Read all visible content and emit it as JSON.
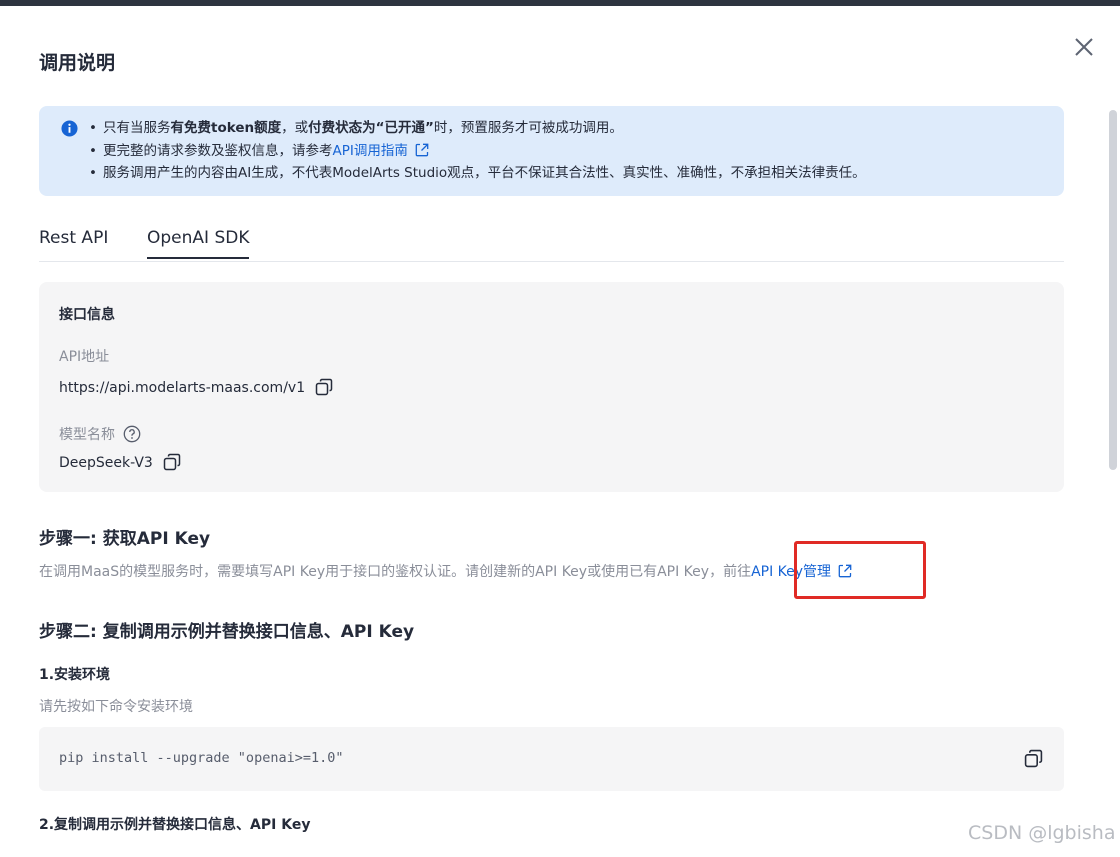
{
  "dialog": {
    "title": "调用说明"
  },
  "notice": {
    "line1": {
      "prefix": "只有当服务",
      "bold1": "有免费token额度",
      "mid": "，或",
      "bold2": "付费状态为“已开通”",
      "suffix": "时，预置服务才可被成功调用。"
    },
    "line2": {
      "prefix": "更完整的请求参数及鉴权信息，请参考",
      "link": "API调用指南"
    },
    "line3": "服务调用产生的内容由AI生成，不代表ModelArts Studio观点，平台不保证其合法性、真实性、准确性，不承担相关法律责任。",
    "bullet": "•"
  },
  "tabs": [
    {
      "label": "Rest API",
      "active": false
    },
    {
      "label": "OpenAI SDK",
      "active": true
    }
  ],
  "interface_info": {
    "title": "接口信息",
    "api_url_label": "API地址",
    "api_url_value": "https://api.modelarts-maas.com/v1",
    "model_name_label": "模型名称",
    "model_name_value": "DeepSeek-V3"
  },
  "step1": {
    "title": "步骤一: 获取API Key",
    "desc": "在调用MaaS的模型服务时，需要填写API Key用于接口的鉴权认证。请创建新的API Key或使用已有API Key，前往",
    "link": "API Key管理"
  },
  "step2": {
    "title": "步骤二: 复制调用示例并替换接口信息、API Key",
    "sub1_title": "1.安装环境",
    "sub1_desc": "请先按如下命令安装环境",
    "code": "pip install --upgrade \"openai>=1.0\"",
    "sub2_title": "2.复制调用示例并替换接口信息、API Key"
  },
  "watermark": "CSDN @lgbisha",
  "colors": {
    "link": "#1764d4",
    "notice_bg": "#deebfb",
    "highlight": "#e02a25"
  }
}
